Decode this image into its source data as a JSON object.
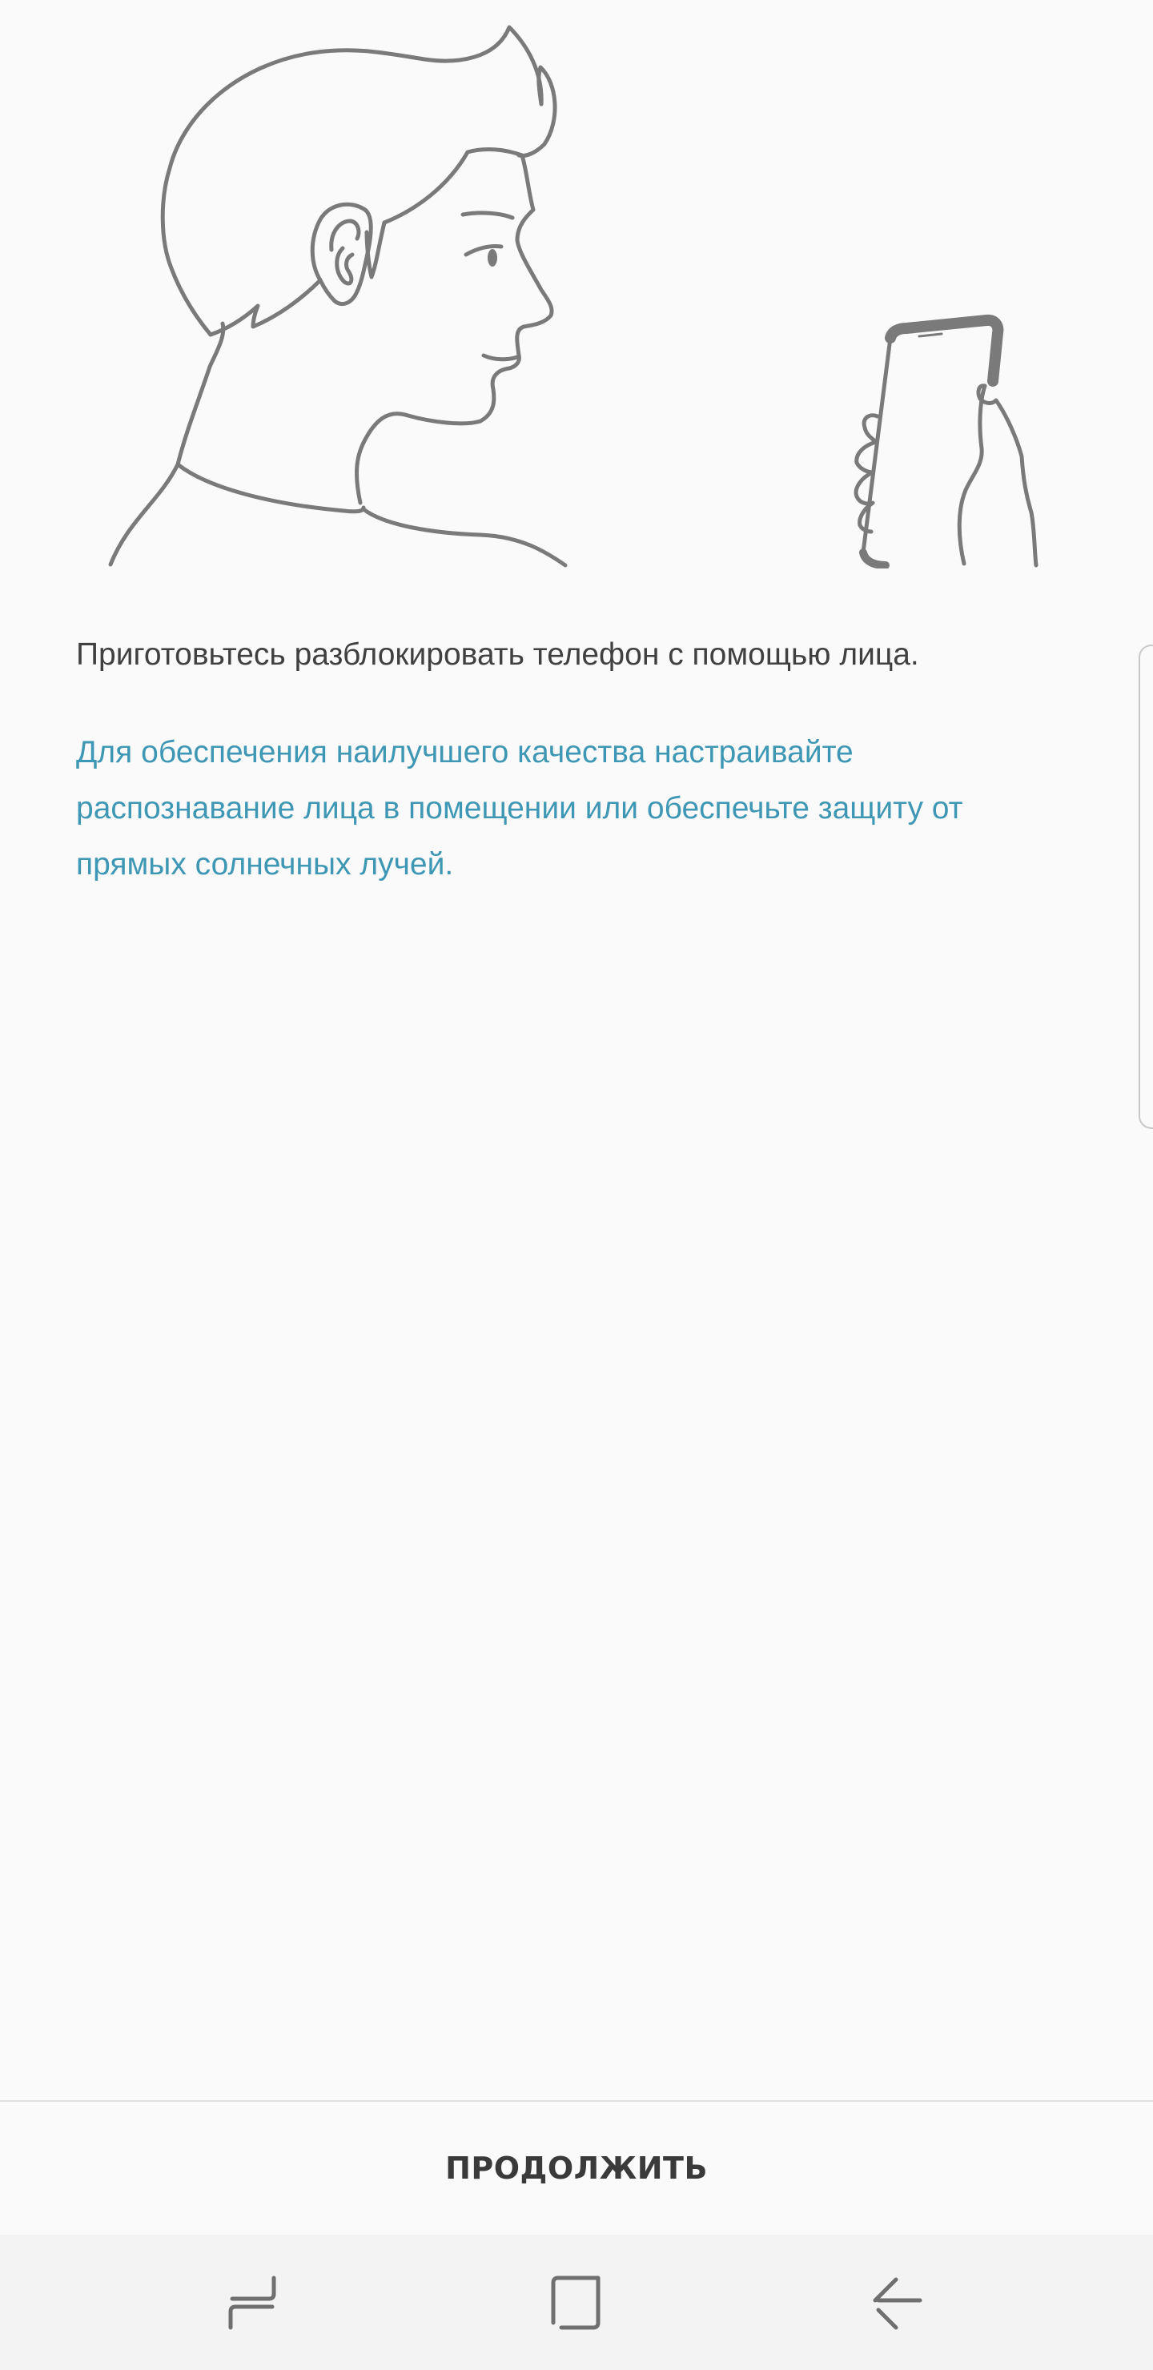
{
  "content": {
    "heading": "Приготовьтесь разблокировать телефон с помощью лица.",
    "hint": "Для обеспечения наилучшего качества настраивайте распознавание лица в помещении или обеспечьте защиту от прямых солнечных лучей."
  },
  "footer": {
    "continue_label": "ПРОДОЛЖИТЬ"
  },
  "navbar": {
    "recents_icon": "recent-apps-icon",
    "home_icon": "home-icon",
    "back_icon": "back-arrow-icon"
  },
  "illustration": {
    "icon": "face-and-phone-illustration"
  },
  "colors": {
    "background": "#fafafa",
    "heading_text": "#404040",
    "hint_text": "#3e97b4",
    "navbar_bg": "#f3f3f3",
    "line_art": "#7a7a7a"
  }
}
